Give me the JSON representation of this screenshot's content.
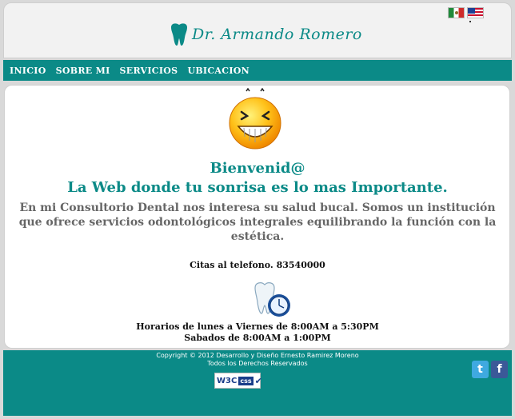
{
  "header": {
    "logo_text": "Dr. Armando Romero",
    "flags": [
      "mexico-flag-icon",
      "usa-flag-icon"
    ]
  },
  "nav": {
    "items": [
      {
        "label": "INICIO"
      },
      {
        "label": "SOBRE MI"
      },
      {
        "label": "SERVICIOS"
      },
      {
        "label": "UBICACION"
      }
    ]
  },
  "main": {
    "welcome_title": "Bienvenid@",
    "welcome_subtitle": "La Web donde tu sonrisa es lo mas Importante.",
    "intro": "En mi Consultorio Dental nos interesa su salud bucal. Somos un institución que ofrece servicios odontológicos integrales equilibrando la función con la estética.",
    "phone": "Citas al telefono. 83540000",
    "hours_weekday": "Horarios de lunes a Viernes de 8:00AM a 5:30PM",
    "hours_saturday": "Sabados de 8:00AM a 1:00PM"
  },
  "footer": {
    "copyright": "Copyright © 2012 Desarrollo y Diseño Ernesto Ramirez Moreno",
    "rights": "Todos los Derechos Reservados",
    "w3c_label": "W3C",
    "css_label": "css"
  },
  "colors": {
    "brand_teal": "#0b8a87",
    "text_gray": "#666666"
  }
}
